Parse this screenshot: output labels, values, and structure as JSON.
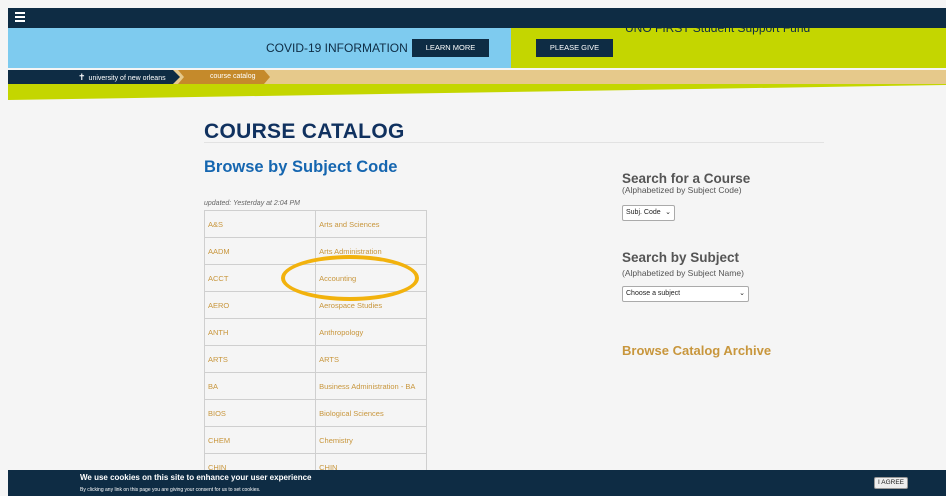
{
  "topnav": {
    "menu_icon": "hamburger-icon"
  },
  "covid_banner": {
    "text": "COVID-19 INFORMATION",
    "button": "LEARN MORE"
  },
  "give_banner": {
    "button": "PLEASE GIVE",
    "text": "UNO FIRST Student Support Fund"
  },
  "breadcrumb": {
    "home": "university of new orleans",
    "home_icon": "cross-icon",
    "current": "course catalog"
  },
  "main": {
    "title": "COURSE CATALOG",
    "subtitle": "Browse by Subject Code",
    "updated": "updated: Yesterday at 2:04 PM",
    "subjects": [
      {
        "code": "A&S",
        "name": "Arts and Sciences"
      },
      {
        "code": "AADM",
        "name": "Arts Administration"
      },
      {
        "code": "ACCT",
        "name": "Accounting"
      },
      {
        "code": "AERO",
        "name": "Aerospace Studies"
      },
      {
        "code": "ANTH",
        "name": "Anthropology"
      },
      {
        "code": "ARTS",
        "name": "ARTS"
      },
      {
        "code": "BA",
        "name": "Business Administration - BA"
      },
      {
        "code": "BIOS",
        "name": "Biological Sciences"
      },
      {
        "code": "CHEM",
        "name": "Chemistry"
      },
      {
        "code": "CHIN",
        "name": "CHIN"
      }
    ]
  },
  "sidebar": {
    "course_title": "Search for a Course",
    "course_sub": "(Alphabetized by Subject Code)",
    "course_select": "Subj. Code",
    "subject_title": "Search by Subject",
    "subject_sub": "(Alphabetized by Subject Name)",
    "subject_select": "Choose a subject",
    "archive": "Browse Catalog Archive"
  },
  "cookie": {
    "title": "We use cookies on this site to enhance your user experience",
    "text": "By clicking any link on this page you are giving your consent for us to set cookies.",
    "button": "I AGREE"
  },
  "colors": {
    "navy": "#0e2c44",
    "light_blue": "#7ecbef",
    "lime": "#c4d600",
    "gold": "#c8963c",
    "highlight": "#f2b20d"
  }
}
